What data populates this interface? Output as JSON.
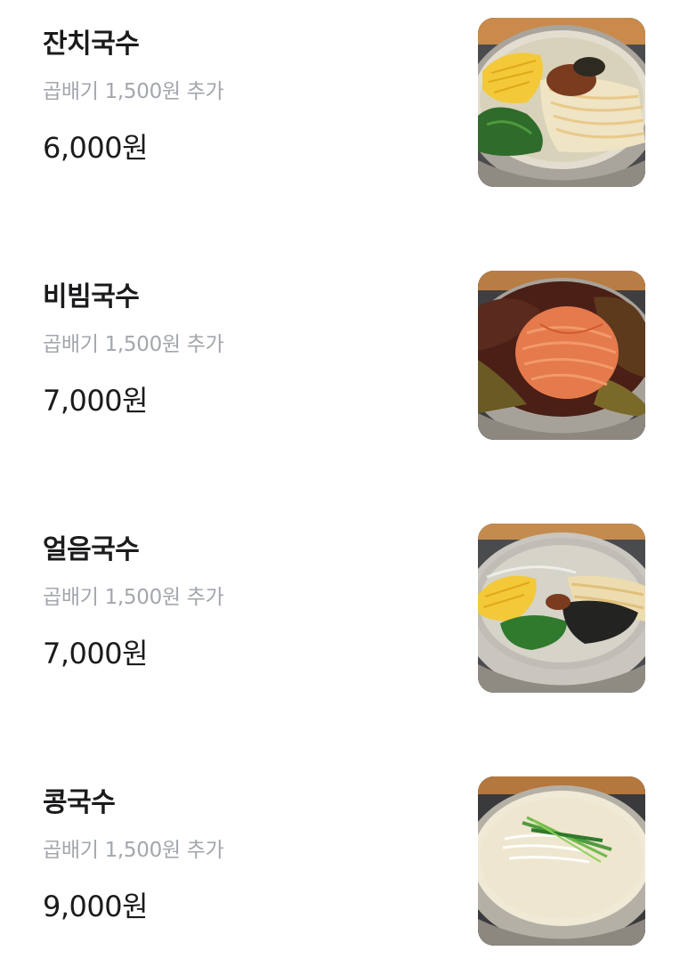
{
  "menu": {
    "items": [
      {
        "name": "잔치국수",
        "option": "곱배기 1,500원 추가",
        "price": "6,000원",
        "image": "janchi-guksu-photo"
      },
      {
        "name": "비빔국수",
        "option": "곱배기 1,500원 추가",
        "price": "7,000원",
        "image": "bibim-guksu-photo"
      },
      {
        "name": "얼음국수",
        "option": "곱배기 1,500원 추가",
        "price": "7,000원",
        "image": "eoreum-guksu-photo"
      },
      {
        "name": "콩국수",
        "option": "곱배기 1,500원 추가",
        "price": "9,000원",
        "image": "kong-guksu-photo"
      }
    ]
  },
  "colors": {
    "text_primary": "#1b1b1d",
    "text_secondary": "#a3a7ad",
    "background": "#ffffff"
  }
}
